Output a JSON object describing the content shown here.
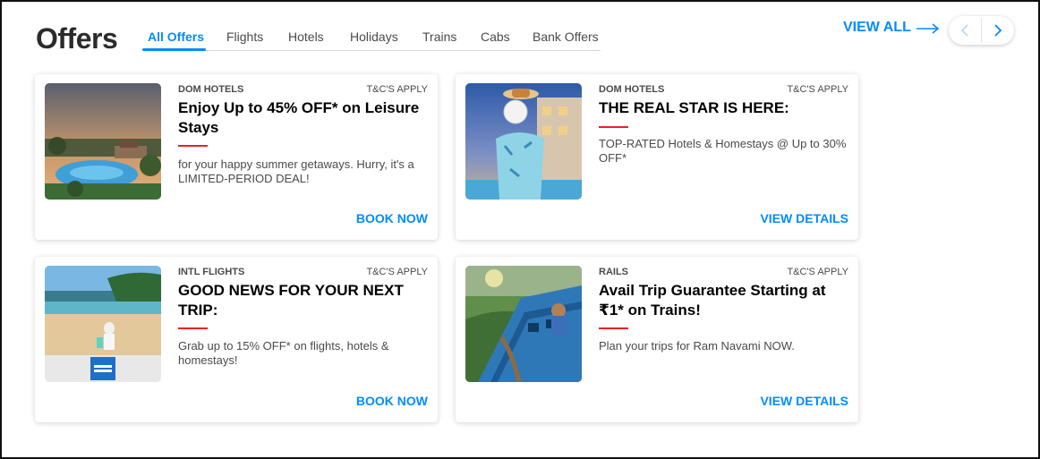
{
  "page": {
    "title": "Offers"
  },
  "tabs": [
    {
      "label": "All Offers",
      "active": true
    },
    {
      "label": "Flights"
    },
    {
      "label": "Hotels"
    },
    {
      "label": "Holidays"
    },
    {
      "label": "Trains"
    },
    {
      "label": "Cabs"
    },
    {
      "label": "Bank Offers"
    }
  ],
  "header": {
    "view_all": "VIEW ALL"
  },
  "colors": {
    "accent": "#008cff",
    "red_rule": "#eb2026",
    "text": "#000000",
    "muted": "#4a4a4a"
  },
  "offers": [
    {
      "category": "DOM HOTELS",
      "tnc": "T&C'S APPLY",
      "headline": "Enjoy Up to 45% OFF* on Leisure Stays",
      "description": "for your happy summer getaways. Hurry, it's a LIMITED-PERIOD DEAL!",
      "cta": "BOOK NOW",
      "image": "resort-pool-sunset"
    },
    {
      "category": "DOM HOTELS",
      "tnc": "T&C'S APPLY",
      "headline": "THE REAL STAR IS HERE:",
      "description": "TOP-RATED Hotels & Homestays @ Up to 30% OFF*",
      "cta": "VIEW DETAILS",
      "image": "man-with-plate-by-pool"
    },
    {
      "category": "INTL FLIGHTS",
      "tnc": "T&C'S APPLY",
      "headline": "GOOD NEWS FOR YOUR NEXT TRIP:",
      "description": "Grab up to 15% OFF* on flights, hotels & homestays!",
      "cta": "BOOK NOW",
      "image": "beach-traveller-amex"
    },
    {
      "category": "RAILS",
      "tnc": "T&C'S APPLY",
      "headline": "Avail Trip Guarantee Starting at ₹1* on Trains!",
      "description": "Plan your trips for Ram Navami NOW.",
      "cta": "VIEW DETAILS",
      "image": "woman-on-blue-train"
    }
  ]
}
